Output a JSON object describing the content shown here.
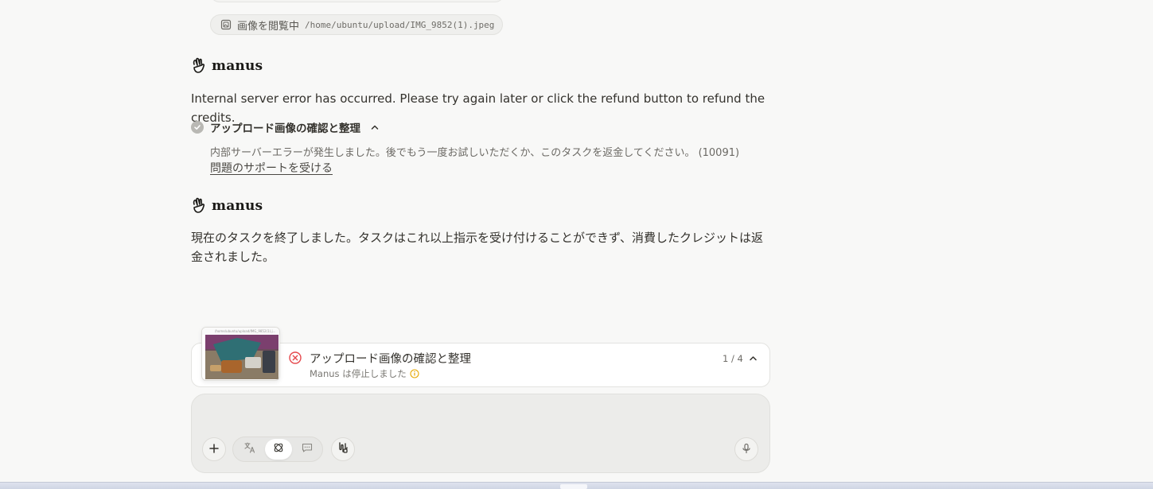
{
  "file_chip": {
    "label": "画像を閲覧中",
    "path": "/home/ubuntu/upload/IMG_9852(1).jpeg",
    "icon": "image-file-icon"
  },
  "brand": {
    "name": "manus",
    "icon": "manus-hand-logo-icon"
  },
  "messages": [
    {
      "text": "Internal server error has occurred. Please try again later or click the refund button to refund the credits."
    },
    {
      "text": "現在のタスクを終了しました。タスクはこれ以上指示を受け付けることができず、消費したクレジットは返金されました。"
    }
  ],
  "step": {
    "title": "アップロード画像の確認と整理",
    "detail": "内部サーバーエラーが発生しました。後でもう一度お試しいただくか、このタスクを返金してください。 (10091)",
    "support_link": "問題のサポートを受ける",
    "status_icon": "check-circle-icon",
    "toggle_icon": "chevron-up-icon"
  },
  "task_card": {
    "title": "アップロード画像の確認と整理",
    "status": "Manus は停止しました",
    "counter": "1 / 4",
    "thumb_caption": "/home/ubuntu/upload/IMG_9852(1).j...",
    "status_icon": "error-x-circle-icon",
    "info_icon": "info-icon",
    "accent_error": "#e5484d",
    "accent_warning": "#e6a700"
  },
  "composer": {
    "placeholder": "",
    "buttons": [
      "plus-icon",
      "translate-mode-icon",
      "agent-mode-icon",
      "chat-mode-icon",
      "connector-icon",
      "microphone-icon"
    ]
  }
}
